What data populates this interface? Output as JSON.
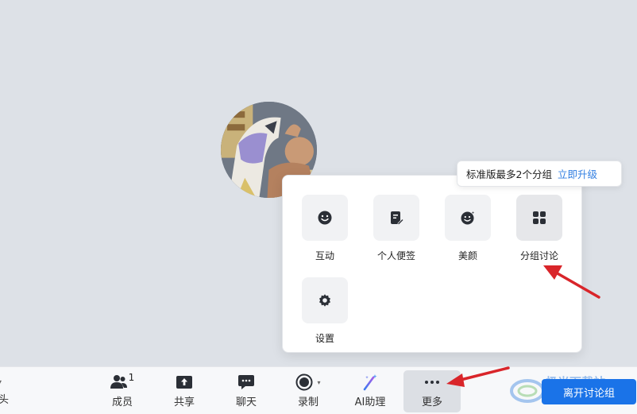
{
  "upsell": {
    "text": "标准版最多2个分组",
    "link": "立即升级"
  },
  "more_panel": {
    "items": [
      {
        "label": "互动",
        "icon": "smile-icon"
      },
      {
        "label": "个人便签",
        "icon": "note-edit-icon"
      },
      {
        "label": "美颜",
        "icon": "beauty-sparkle-icon"
      },
      {
        "label": "分组讨论",
        "icon": "grid-four-icon"
      },
      {
        "label": "设置",
        "icon": "gear-icon"
      }
    ]
  },
  "toolbar": {
    "edge_label": "头",
    "items": [
      {
        "label": "成员",
        "icon": "members-icon",
        "count": "1"
      },
      {
        "label": "共享",
        "icon": "share-screen-icon"
      },
      {
        "label": "聊天",
        "icon": "chat-icon"
      },
      {
        "label": "录制",
        "icon": "record-icon"
      },
      {
        "label": "AI助理",
        "icon": "ai-wand-icon"
      },
      {
        "label": "更多",
        "icon": "more-dots-icon"
      }
    ],
    "leave_label": "离开讨论组"
  },
  "watermark": {
    "text": "极光下载站"
  },
  "colors": {
    "background": "#dde1e7",
    "accent": "#1a73e8",
    "link": "#2f7de1",
    "annotation_arrow": "#d9252a"
  }
}
